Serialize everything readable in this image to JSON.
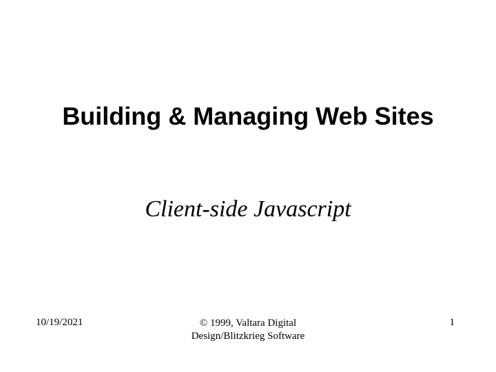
{
  "slide": {
    "title": "Building & Managing Web Sites",
    "subtitle": "Client-side Javascript"
  },
  "footer": {
    "date": "10/19/2021",
    "copyright_line1": "© 1999, Valtara Digital",
    "copyright_line2": "Design/Blitzkrieg Software",
    "page_number": "1"
  }
}
